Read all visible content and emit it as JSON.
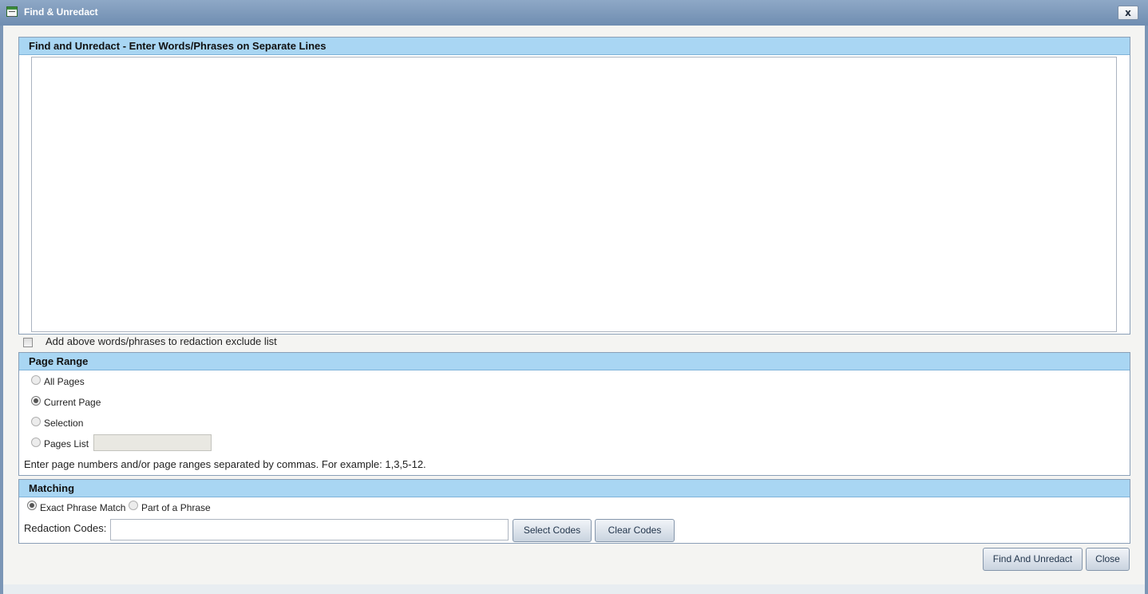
{
  "window": {
    "title": "Find & Unredact",
    "close_label": "x"
  },
  "find_panel": {
    "header": "Find and Unredact - Enter Words/Phrases on Separate Lines",
    "textarea_value": ""
  },
  "exclude": {
    "label": "Add above words/phrases to redaction exclude list",
    "checked": false
  },
  "page_range": {
    "header": "Page Range",
    "options": [
      {
        "label": "All Pages",
        "checked": false
      },
      {
        "label": "Current Page",
        "checked": true
      },
      {
        "label": "Selection",
        "checked": false
      },
      {
        "label": "Pages List",
        "checked": false
      }
    ],
    "pages_list_value": "",
    "hint": "Enter page numbers and/or page ranges separated by commas. For example: 1,3,5-12."
  },
  "matching": {
    "header": "Matching",
    "options": [
      {
        "label": "Exact Phrase Match",
        "checked": true
      },
      {
        "label": "Part of a Phrase",
        "checked": false
      }
    ],
    "codes_label": "Redaction Codes:",
    "codes_value": "",
    "select_codes": "Select Codes",
    "clear_codes": "Clear Codes"
  },
  "footer": {
    "find_and_unredact": "Find And Unredact",
    "close": "Close"
  }
}
